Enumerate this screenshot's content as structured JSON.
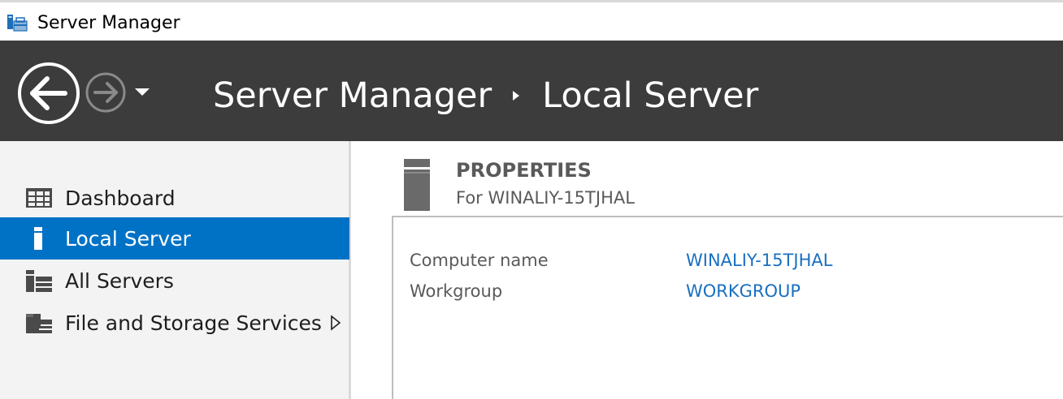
{
  "window": {
    "title": "Server Manager",
    "icon": "server-manager-icon"
  },
  "header": {
    "breadcrumb": [
      "Server Manager",
      "Local Server"
    ],
    "back_icon": "back-arrow-icon",
    "forward_icon": "forward-arrow-icon",
    "dropdown_icon": "chevron-down-icon"
  },
  "sidebar": {
    "items": [
      {
        "label": "Dashboard",
        "icon": "dashboard-icon",
        "active": false
      },
      {
        "label": "Local Server",
        "icon": "local-server-icon",
        "active": true
      },
      {
        "label": "All Servers",
        "icon": "all-servers-icon",
        "active": false
      },
      {
        "label": "File and Storage Services",
        "icon": "file-storage-icon",
        "active": false,
        "has_submenu": true
      }
    ]
  },
  "main": {
    "properties": {
      "title": "PROPERTIES",
      "subtitle": "For WINALIY-15TJHAL",
      "rows": [
        {
          "label": "Computer name",
          "value": "WINALIY-15TJHAL"
        },
        {
          "label": "Workgroup",
          "value": "WORKGROUP"
        }
      ]
    }
  },
  "colors": {
    "header_bg": "#3c3c3c",
    "sidebar_bg": "#f3f3f3",
    "active_bg": "#0072c6",
    "link": "#1a6fc0",
    "muted_text": "#5a5a5a"
  }
}
